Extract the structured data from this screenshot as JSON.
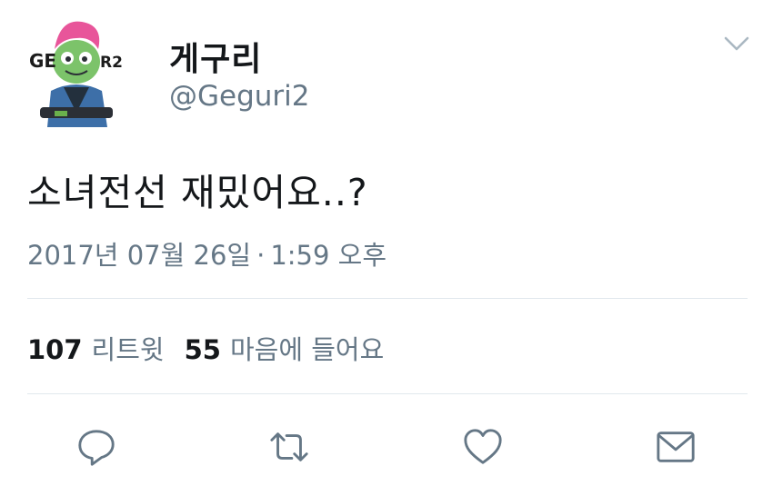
{
  "profile": {
    "display_name": "게구리",
    "handle": "@Geguri2",
    "avatar_lettering": "GEGURI2"
  },
  "tweet": {
    "text": "소녀전선 재밌어요..?",
    "date": "2017년 07월 26일",
    "separator": "·",
    "time": "1:59 오후"
  },
  "stats": {
    "retweets_count": "107",
    "retweets_label": "리트윗",
    "likes_count": "55",
    "likes_label": "마음에 들어요"
  },
  "actions": [
    "reply-icon",
    "retweet-icon",
    "like-icon",
    "direct-message-icon"
  ],
  "colors": {
    "text_primary": "#14171a",
    "text_secondary": "#657786",
    "icon": "#657786",
    "divider": "#e1e8ed"
  }
}
